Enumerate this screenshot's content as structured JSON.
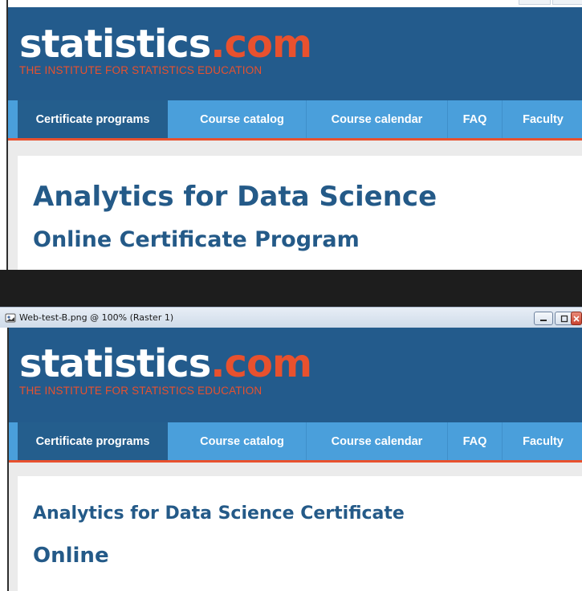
{
  "colors": {
    "header_bg": "#235b8c",
    "accent_orange": "#e8512e",
    "nav_bg": "#4a9fdb",
    "nav_active_bg": "#245e8d",
    "heading_color": "#245a88",
    "gray_band": "#ebebeb",
    "separator": "#1d1d1d"
  },
  "panel_a": {
    "logo": {
      "main": "statistics",
      "tld": ".com"
    },
    "tagline": "THE INSTITUTE FOR STATISTICS EDUCATION",
    "nav": [
      {
        "label": "Certificate programs",
        "active": true
      },
      {
        "label": "Course catalog",
        "active": false
      },
      {
        "label": "Course calendar",
        "active": false
      },
      {
        "label": "FAQ",
        "active": false
      },
      {
        "label": "Faculty",
        "active": false
      }
    ],
    "heading_line1": "Analytics for Data Science",
    "heading_line2": "Online Certificate Program"
  },
  "panel_b": {
    "window_title": "Web-test-B.png @ 100% (Raster 1)",
    "app_icon": "image-file-icon",
    "window_buttons": [
      "minimize-icon",
      "maximize-icon",
      "close-icon"
    ],
    "logo": {
      "main": "statistics",
      "tld": ".com"
    },
    "tagline": "THE INSTITUTE FOR STATISTICS EDUCATION",
    "nav": [
      {
        "label": "Certificate programs",
        "active": true
      },
      {
        "label": "Course catalog",
        "active": false
      },
      {
        "label": "Course calendar",
        "active": false
      },
      {
        "label": "FAQ",
        "active": false
      },
      {
        "label": "Faculty",
        "active": false
      }
    ],
    "heading_line1": "Analytics for Data Science Certificate",
    "heading_line2": "Online"
  }
}
